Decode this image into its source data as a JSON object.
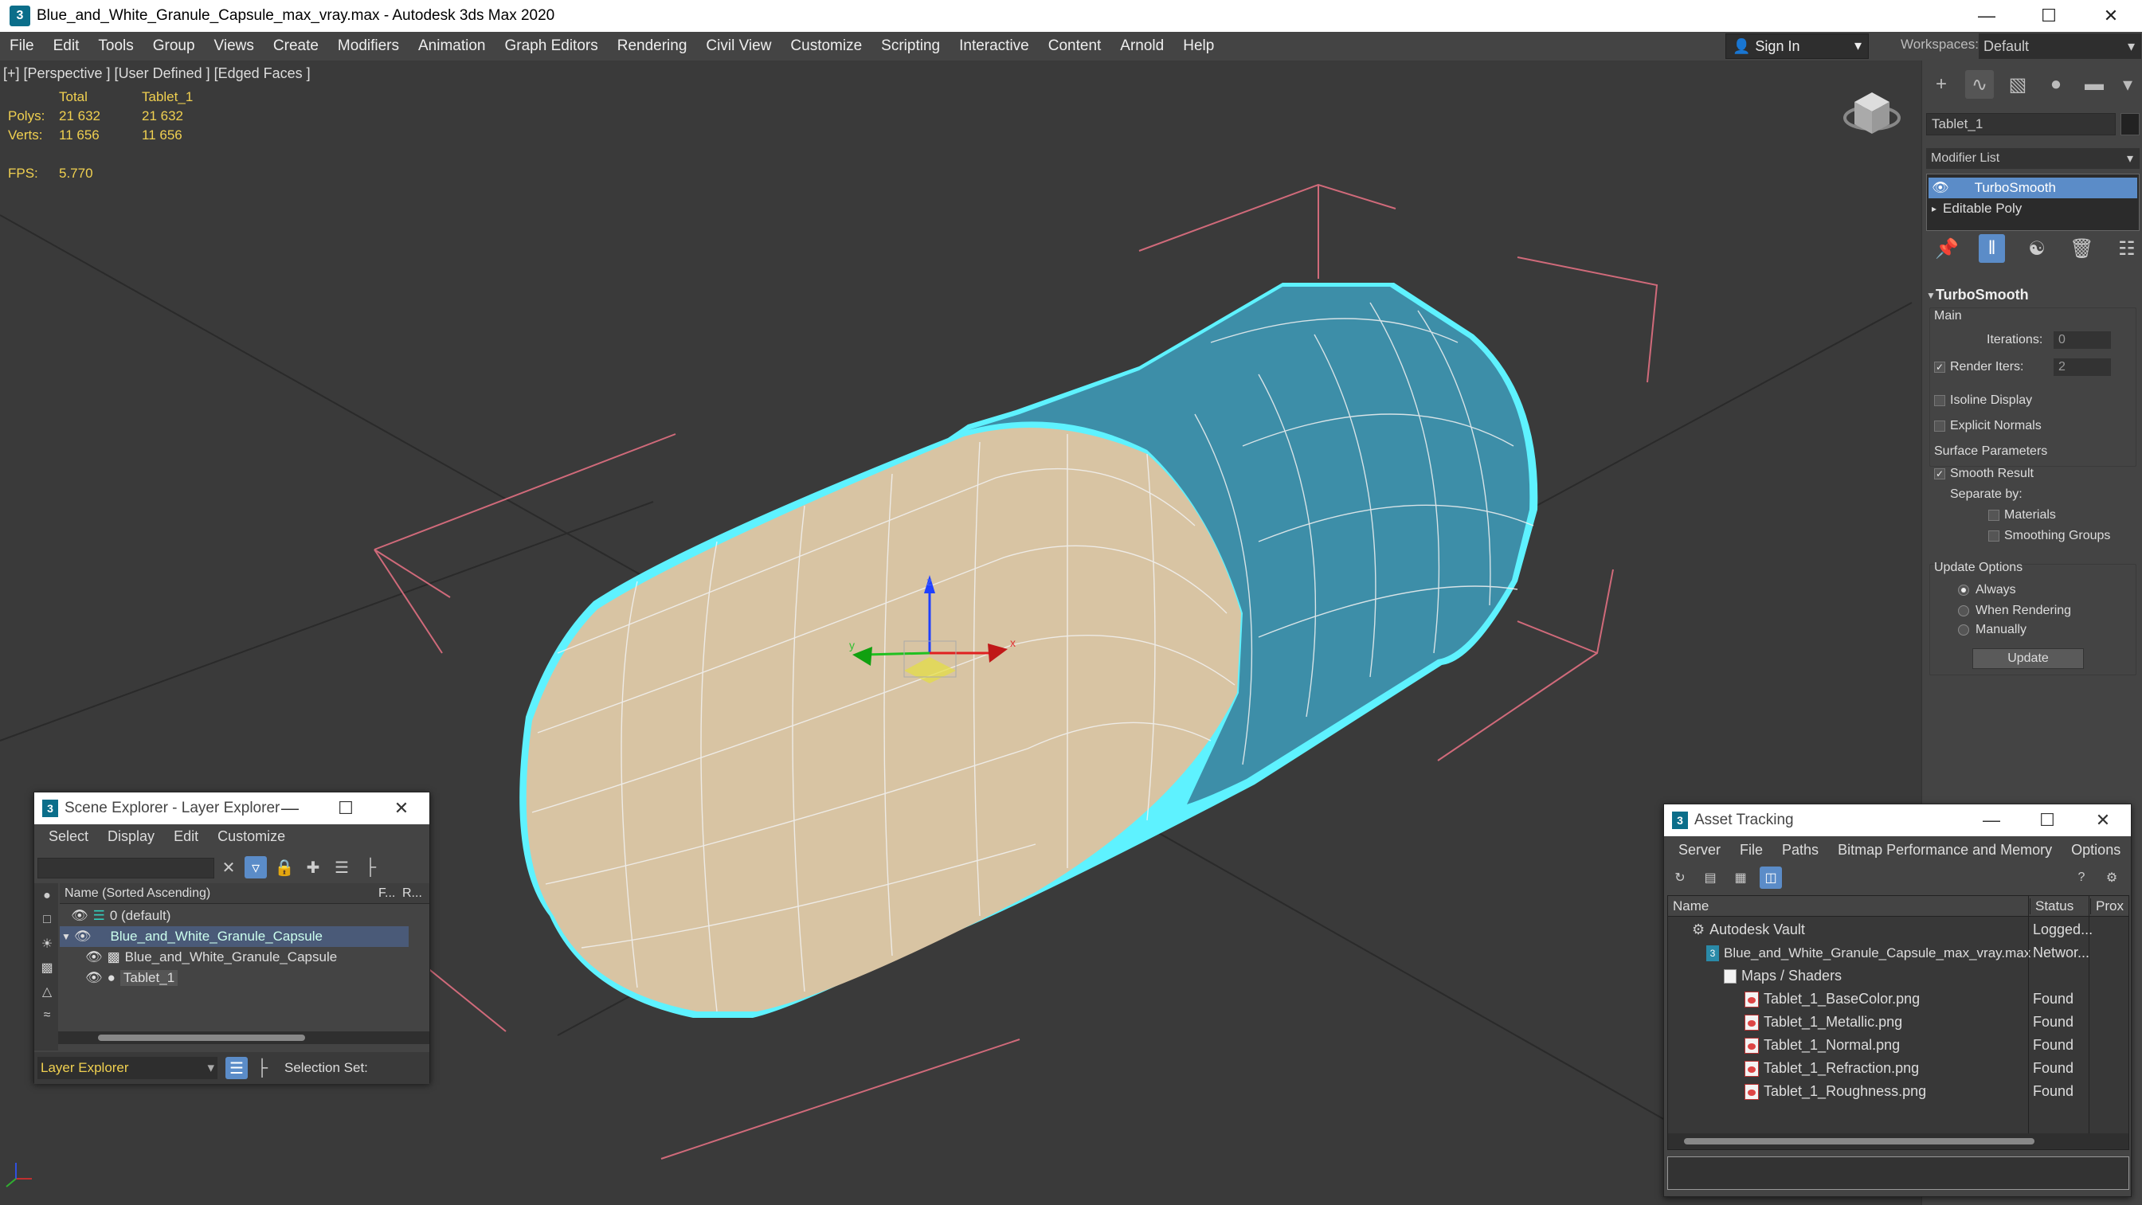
{
  "window": {
    "title": "Blue_and_White_Granule_Capsule_max_vray.max - Autodesk 3ds Max 2020",
    "app_icon": "3"
  },
  "menu": [
    "File",
    "Edit",
    "Tools",
    "Group",
    "Views",
    "Create",
    "Modifiers",
    "Animation",
    "Graph Editors",
    "Rendering",
    "Civil View",
    "Customize",
    "Scripting",
    "Interactive",
    "Content",
    "Arnold",
    "Help"
  ],
  "signin": {
    "label": "Sign In"
  },
  "workspace": {
    "label": "Workspaces:",
    "value": "Default"
  },
  "viewport": {
    "label": "[+] [Perspective ] [User Defined ] [Edged Faces ]",
    "stats": {
      "col_total": "Total",
      "col_obj": "Tablet_1",
      "polys_label": "Polys:",
      "polys_total": "21 632",
      "polys_obj": "21 632",
      "verts_label": "Verts:",
      "verts_total": "11 656",
      "verts_obj": "11 656",
      "fps_label": "FPS:",
      "fps_value": "5.770"
    },
    "gizmo": {
      "x": "x",
      "y": "y",
      "z": "z"
    }
  },
  "command_panel": {
    "object_name": "Tablet_1",
    "modifier_list": "Modifier List",
    "stack": [
      "TurboSmooth",
      "Editable Poly"
    ],
    "rollout": {
      "title": "TurboSmooth",
      "main": "Main",
      "iterations_label": "Iterations:",
      "iterations": "0",
      "render_iters_label": "Render Iters:",
      "render_iters": "2",
      "isoline": "Isoline Display",
      "explicit_normals": "Explicit Normals",
      "surface_params": "Surface Parameters",
      "smooth_result": "Smooth Result",
      "separate_by": "Separate by:",
      "materials": "Materials",
      "smoothing_groups": "Smoothing Groups",
      "update_options": "Update Options",
      "always": "Always",
      "when_rendering": "When Rendering",
      "manually": "Manually",
      "update_btn": "Update"
    }
  },
  "scene_explorer": {
    "title": "Scene Explorer - Layer Explorer",
    "menu": [
      "Select",
      "Display",
      "Edit",
      "Customize"
    ],
    "col_name": "Name (Sorted Ascending)",
    "col_f": "F...",
    "col_r": "R...",
    "rows": [
      "0 (default)",
      "Blue_and_White_Granule_Capsule",
      "Blue_and_White_Granule_Capsule",
      "Tablet_1"
    ],
    "footer_layer": "Layer Explorer",
    "footer_selset": "Selection Set:"
  },
  "asset_tracking": {
    "title": "Asset Tracking",
    "menu": [
      "Server",
      "File",
      "Paths",
      "Bitmap Performance and Memory",
      "Options"
    ],
    "cols": {
      "name": "Name",
      "status": "Status",
      "proxy": "Prox"
    },
    "rows": [
      {
        "name": "Autodesk Vault",
        "status": "Logged..."
      },
      {
        "name": "Blue_and_White_Granule_Capsule_max_vray.max",
        "status": "Networ..."
      },
      {
        "name": "Maps / Shaders",
        "status": ""
      },
      {
        "name": "Tablet_1_BaseColor.png",
        "status": "Found"
      },
      {
        "name": "Tablet_1_Metallic.png",
        "status": "Found"
      },
      {
        "name": "Tablet_1_Normal.png",
        "status": "Found"
      },
      {
        "name": "Tablet_1_Refraction.png",
        "status": "Found"
      },
      {
        "name": "Tablet_1_Roughness.png",
        "status": "Found"
      }
    ]
  },
  "colors": {
    "accent": "#5b8cc8",
    "capsule_cream": "#d8c4a3",
    "capsule_blue": "#3d8ea8",
    "selection_cyan": "#5ef2ff"
  }
}
